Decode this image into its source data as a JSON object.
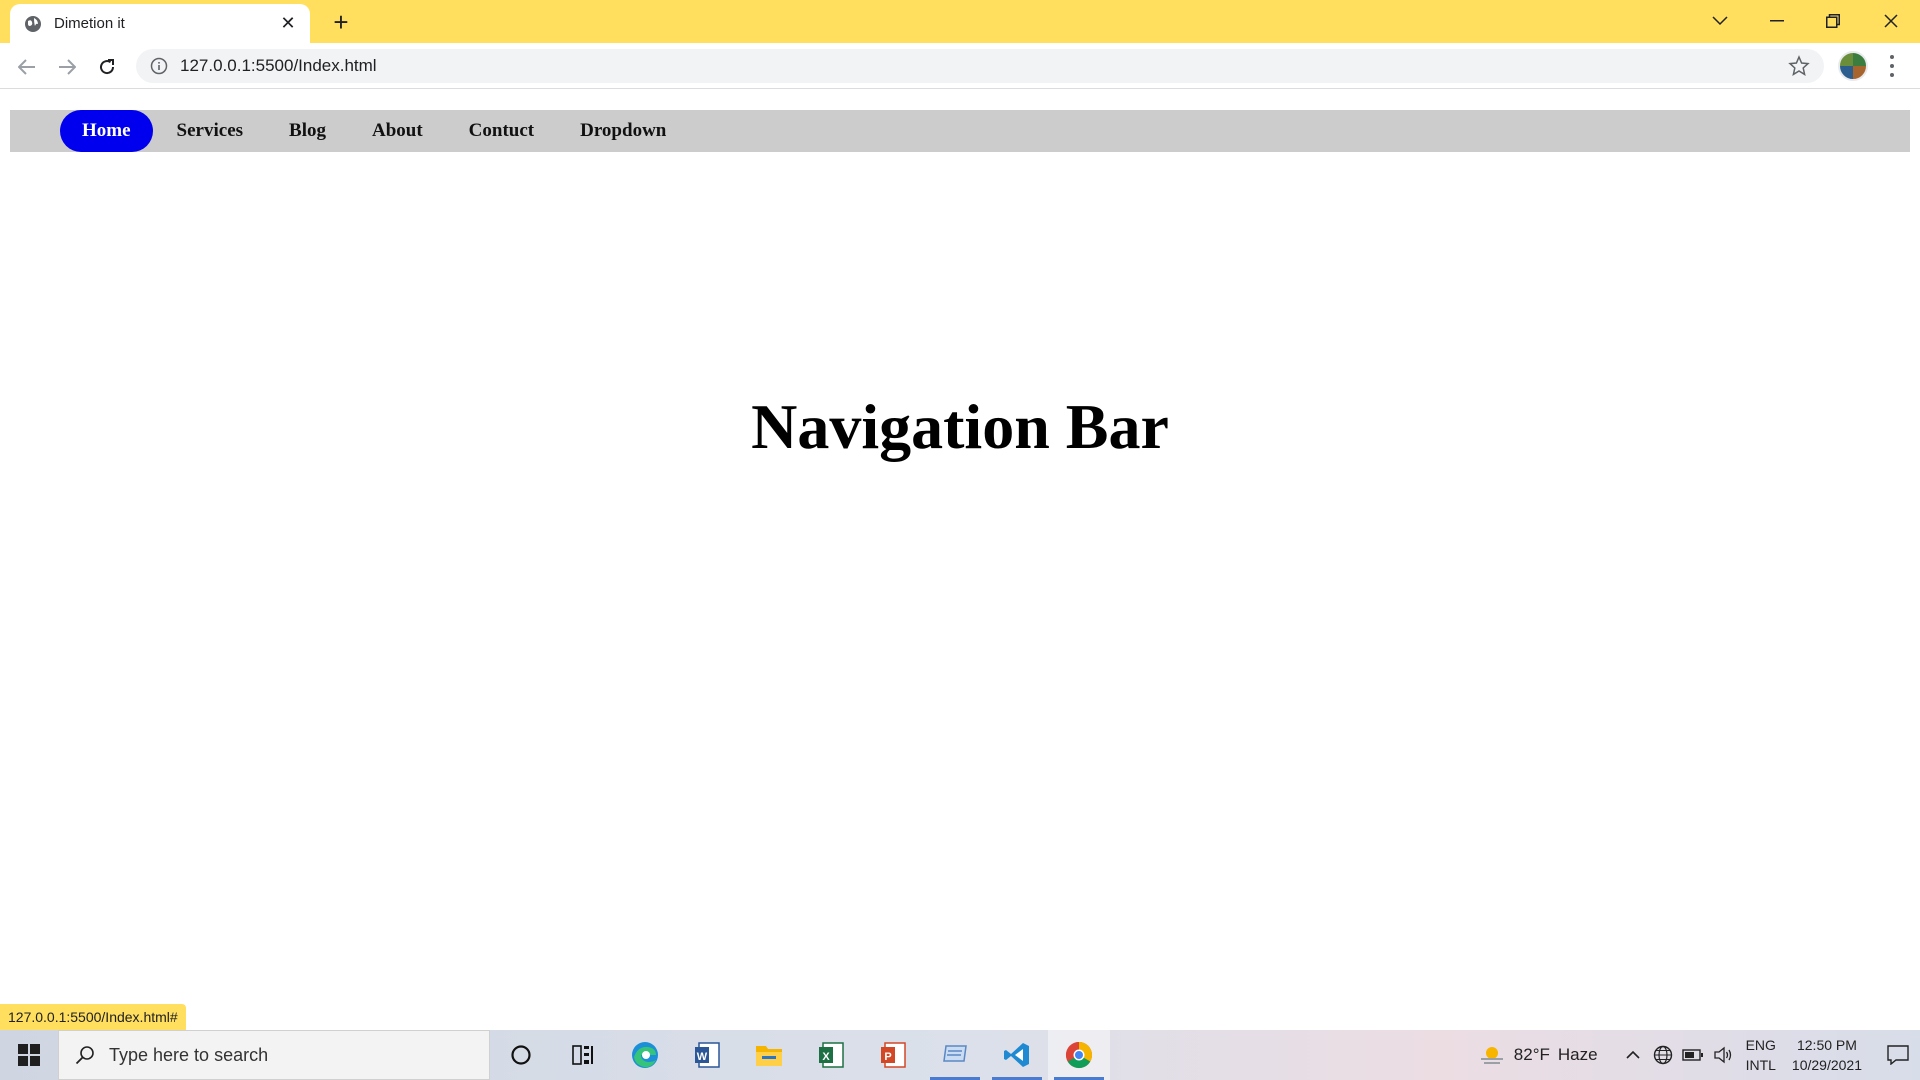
{
  "browser": {
    "tab_title": "Dimetion it",
    "tab_close": "✕",
    "new_tab": "+",
    "url": "127.0.0.1:5500/Index.html",
    "status_url": "127.0.0.1:5500/Index.html#",
    "accent_color": "#ffdf5d"
  },
  "navbar": {
    "items": [
      {
        "label": "Home",
        "active": true
      },
      {
        "label": "Services",
        "active": false
      },
      {
        "label": "Blog",
        "active": false
      },
      {
        "label": "About",
        "active": false
      },
      {
        "label": "Contuct",
        "active": false
      },
      {
        "label": "Dropdown",
        "active": false
      }
    ],
    "active_color": "#0000ee",
    "bar_color": "#cccccc"
  },
  "main": {
    "heading": "Navigation Bar"
  },
  "taskbar": {
    "search_placeholder": "Type here to search",
    "apps": [
      "cortana-icon",
      "task-view-icon",
      "edge-icon",
      "word-icon",
      "file-explorer-icon",
      "excel-icon",
      "powerpoint-icon",
      "scanner-icon",
      "vscode-icon",
      "chrome-icon"
    ],
    "weather_temp": "82°F",
    "weather_desc": "Haze",
    "lang_top": "ENG",
    "lang_bottom": "INTL",
    "time": "12:50 PM",
    "date": "10/29/2021"
  }
}
